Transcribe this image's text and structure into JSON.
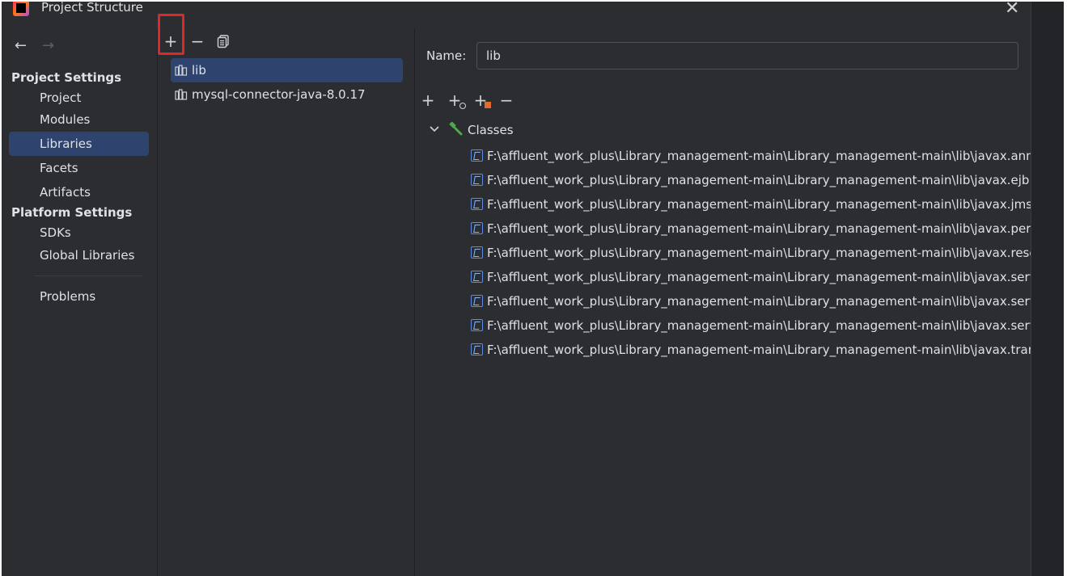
{
  "window": {
    "title": "Project Structure",
    "close_glyph": "✕"
  },
  "nav": {
    "back_glyph": "←",
    "forward_glyph": "→",
    "project_settings_title": "Project Settings",
    "project_settings_items": [
      "Project",
      "Modules",
      "Libraries",
      "Facets",
      "Artifacts"
    ],
    "platform_settings_title": "Platform Settings",
    "platform_settings_items": [
      "SDKs",
      "Global Libraries"
    ],
    "problems": "Problems",
    "selected": "Libraries"
  },
  "libraries": {
    "toolbar": {
      "add_glyph": "+",
      "remove_glyph": "−",
      "copy_icon": "copy-icon"
    },
    "items": [
      "lib",
      "mysql-connector-java-8.0.17"
    ],
    "selected": "lib"
  },
  "details": {
    "name_label": "Name:",
    "name_value": "lib",
    "toolbar": {
      "add_glyph": "+",
      "remove_glyph": "−"
    },
    "tree_root": "Classes",
    "jars": [
      "F:\\affluent_work_plus\\Library_management-main\\Library_management-main\\lib\\javax.annotation",
      "F:\\affluent_work_plus\\Library_management-main\\Library_management-main\\lib\\javax.ejb.jar",
      "F:\\affluent_work_plus\\Library_management-main\\Library_management-main\\lib\\javax.jms.jar",
      "F:\\affluent_work_plus\\Library_management-main\\Library_management-main\\lib\\javax.persistence",
      "F:\\affluent_work_plus\\Library_management-main\\Library_management-main\\lib\\javax.resource",
      "F:\\affluent_work_plus\\Library_management-main\\Library_management-main\\lib\\javax.servlet.",
      "F:\\affluent_work_plus\\Library_management-main\\Library_management-main\\lib\\javax.servlet.",
      "F:\\affluent_work_plus\\Library_management-main\\Library_management-main\\lib\\javax.servlet.",
      "F:\\affluent_work_plus\\Library_management-main\\Library_management-main\\lib\\javax.transaction"
    ]
  },
  "colors": {
    "background": "#2b2d30",
    "selection": "#2e436e",
    "highlight": "#e0262b",
    "hammer": "#4fa84c",
    "jar_icon": "#5a8ee6"
  }
}
